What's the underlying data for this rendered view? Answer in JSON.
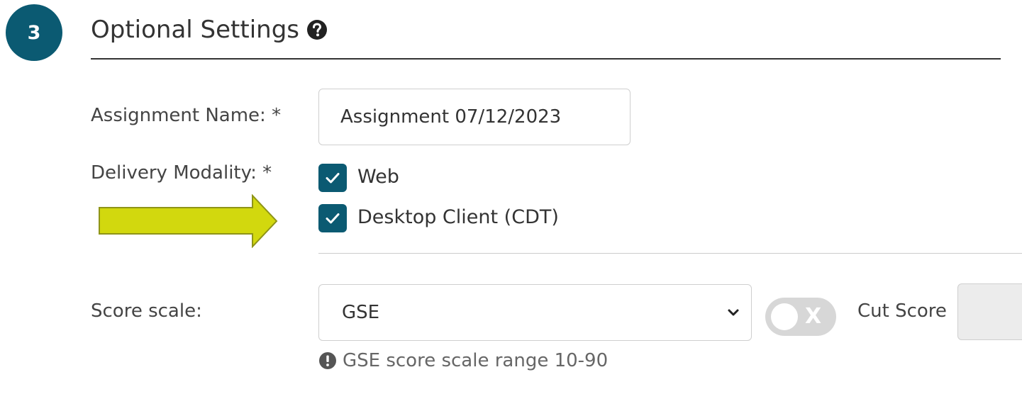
{
  "section": {
    "step_number": "3",
    "title": "Optional Settings",
    "help_icon": "question-circle-icon"
  },
  "assignment_name": {
    "label": "Assignment Name: *",
    "value": "Assignment 07/12/2023"
  },
  "delivery_modality": {
    "label": "Delivery Modality: *",
    "options": [
      {
        "label": "Web",
        "checked": true
      },
      {
        "label": "Desktop Client (CDT)",
        "checked": true
      }
    ]
  },
  "annotation": {
    "arrow_color": "#d2d80e",
    "icon": "arrow-right-icon"
  },
  "score_scale": {
    "label": "Score scale:",
    "selected": "GSE",
    "hint": "GSE score scale range 10-90",
    "hint_icon": "exclamation-circle-icon"
  },
  "cut_score": {
    "label": "Cut Score",
    "toggle_symbol": "X",
    "enabled": false,
    "value": ""
  },
  "colors": {
    "primary": "#0b5a72",
    "toggle_off": "#d7d7d7"
  }
}
